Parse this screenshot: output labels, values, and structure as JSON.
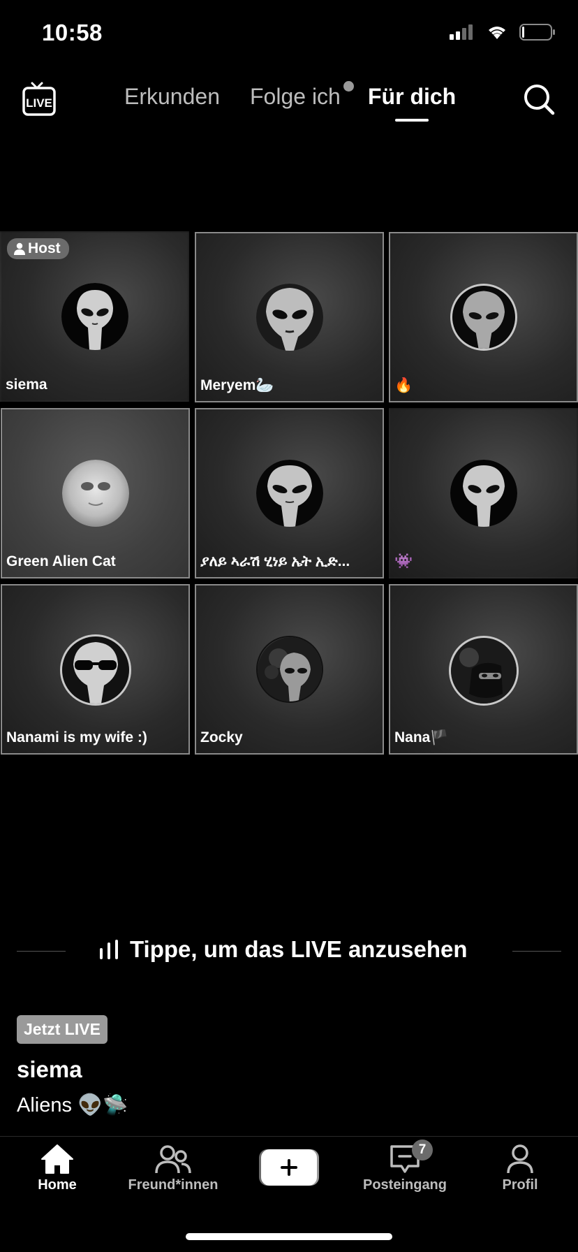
{
  "status_bar": {
    "time": "10:58",
    "icons": [
      "cellular-signal-icon",
      "wifi-icon",
      "battery-icon"
    ]
  },
  "top_nav": {
    "live_icon_label": "LIVE",
    "tabs": [
      {
        "label": "Erkunden",
        "active": false
      },
      {
        "label": "Folge ich",
        "active": false,
        "has_dot": true
      },
      {
        "label": "Für dich",
        "active": true
      }
    ]
  },
  "grid": {
    "host_badge": "Host",
    "tiles": [
      {
        "label": "siema",
        "host": true
      },
      {
        "label": "Meryem🦢"
      },
      {
        "label": "🔥"
      },
      {
        "label": "Green Alien Cat"
      },
      {
        "label": "ያለይ ኣራሽ ሂነይ ኤት ኢድ..."
      },
      {
        "label": "👾"
      },
      {
        "label": "Nanami is my wife :)"
      },
      {
        "label": "Zocky"
      },
      {
        "label": "Nana🏴"
      }
    ]
  },
  "tap_to_watch": "Tippe, um das LIVE anzusehen",
  "stream": {
    "badge": "Jetzt LIVE",
    "user": "siema",
    "description": "Aliens 👽🛸"
  },
  "bottom_nav": {
    "items": [
      {
        "label": "Home",
        "active": true
      },
      {
        "label": "Freund*innen",
        "active": false
      },
      {
        "label": "Posteingang",
        "active": false,
        "badge": "7"
      },
      {
        "label": "Profil",
        "active": false
      }
    ]
  },
  "colors": {
    "background": "#000000",
    "tab_inactive": "#bdbdbd",
    "tile_border": "#8a8a8a",
    "badge_gray": "#6b6b6b"
  }
}
